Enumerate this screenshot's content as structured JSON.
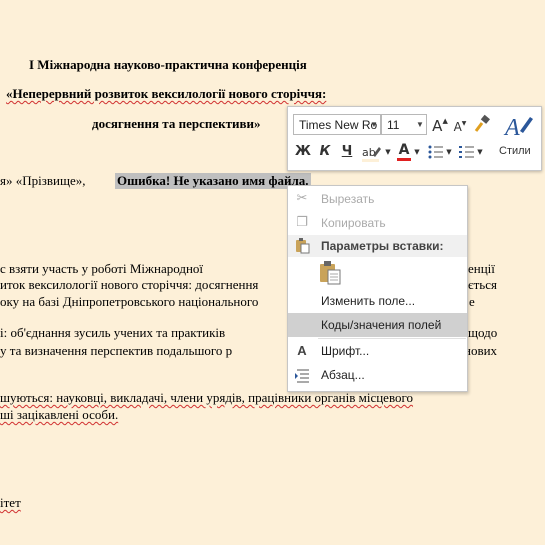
{
  "document": {
    "title_line1": "І Міжнародна науково-практична конференція",
    "title_line2": "«Неперервний розвиток вексилології нового сторіччя:",
    "title_line3": "досягнення та перспективи»",
    "name_row_prefix": "я» «Прізвище»,",
    "error_text": "Ошибка! Не указано имя файла.",
    "p1_line1_left": "с взяти участь у роботі Міжнародної",
    "p1_line1_right": "енції",
    "p1_line2_left": "иток вексилології нового сторіччя: досягнення",
    "p1_line2_right": "ється",
    "p1_line3": "оку на базі Дніпропетровського національного",
    "p1_line3_right": "е",
    "p2_line1_left": "і: об'єднання зусиль учених та практиків",
    "p2_line1_right": "щодо",
    "p2_line2_left": "у та визначення перспектив подальшого р",
    "p2_line2_right": "нових",
    "p3_line1": "шуються: науковці, викладачі, члени урядів, працівники органів місцевого",
    "p3_line2": "ші зацікавлені особи.",
    "footer_fragment": "ітет"
  },
  "mini_toolbar": {
    "font_name": "Times New Ro",
    "font_size": "11",
    "grow_font": "A",
    "shrink_font": "A",
    "bold": "Ж",
    "italic": "К",
    "underline": "Ч",
    "font_color_letter": "A",
    "font_color_accent": "#e02020",
    "styles_label": "Стили"
  },
  "context_menu": {
    "items": [
      {
        "label": "Вырезать",
        "icon": "scissors-icon",
        "enabled": false
      },
      {
        "label": "Копировать",
        "icon": "copy-icon",
        "enabled": false
      },
      {
        "label": "Параметры вставки:",
        "icon": "paste-icon",
        "header": true
      },
      {
        "label": "Изменить поле...",
        "icon": "",
        "enabled": true
      },
      {
        "label": "Коды/значения полей",
        "icon": "",
        "enabled": true,
        "highlighted": true
      },
      {
        "label": "Шрифт...",
        "icon": "font-icon",
        "enabled": true
      },
      {
        "label": "Абзац...",
        "icon": "paragraph-icon",
        "enabled": true
      }
    ]
  }
}
